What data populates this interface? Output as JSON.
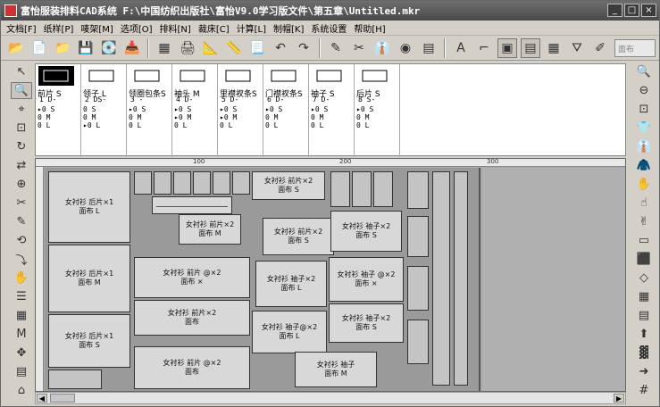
{
  "window": {
    "title": "富怡服装排料CAD系统 F:\\中国纺织出版社\\富怡V9.0学习版文件\\第五章\\Untitled.mkr",
    "buttons": {
      "minimize": "_",
      "maximize": "□",
      "close": "×"
    }
  },
  "menu": [
    "文档[F]",
    "纸样[P]",
    "唛架[M]",
    "选项[O]",
    "排料[N]",
    "裁床[C]",
    "计算[L]",
    "制帽[K]",
    "系统设置",
    "帮助[H]"
  ],
  "toolbar": {
    "icons": [
      "open-icon",
      "new-icon",
      "open-style-icon",
      "save-icon",
      "save-as-icon",
      "import-icon",
      "fill-icon",
      "print-icon",
      "plot-icon",
      "ruler-icon",
      "paper-icon",
      "undo-icon",
      "redo-icon",
      "marker-icon",
      "scissors-icon",
      "shirt-icon",
      "circle-icon",
      "calc-icon",
      "text-icon",
      "measure-icon",
      "window1-icon",
      "window2-icon",
      "grid-icon",
      "tag-icon",
      "roll-icon",
      "wash-icon",
      "piece-icon"
    ],
    "combo_placeholder": "面布"
  },
  "pieces": [
    {
      "name": "前片",
      "size": "S",
      "num": "1",
      "count": "D-",
      "sizes": [
        "0 S",
        "0 M",
        "0 L"
      ],
      "marked": [
        0
      ]
    },
    {
      "name": "领子",
      "size": "L",
      "num": "2",
      "count": "DS-",
      "sizes": [
        "0 S",
        "0 M",
        "0 L"
      ],
      "marked": [
        2
      ]
    },
    {
      "name": "领圈包条S",
      "size": "",
      "num": "3",
      "count": "-",
      "sizes": [
        "0 S",
        "0 M",
        "0 L"
      ],
      "marked": [
        0
      ]
    },
    {
      "name": "袖头",
      "size": "M",
      "num": "4",
      "count": "D-",
      "sizes": [
        "0 S",
        "0 M",
        "0 L"
      ],
      "marked": [
        0,
        1
      ]
    },
    {
      "name": "里襟衩条S",
      "size": "",
      "num": "5",
      "count": "D-",
      "sizes": [
        "0 S",
        "0 M",
        "0 L"
      ],
      "marked": [
        0,
        1
      ]
    },
    {
      "name": "门襟衩条S",
      "size": "",
      "num": "6",
      "count": "D-",
      "sizes": [
        "0 S",
        "0 M",
        "0 L"
      ],
      "marked": [
        0
      ]
    },
    {
      "name": "袖子",
      "size": "S",
      "num": "7",
      "count": "D-",
      "sizes": [
        "0 S",
        "0 M",
        "0 L"
      ],
      "marked": [
        0
      ]
    },
    {
      "name": "后片",
      "size": "S",
      "num": "8",
      "count": "S-",
      "sizes": [
        "0 S",
        "0 M",
        "0 L"
      ],
      "marked": [
        0
      ]
    }
  ],
  "ruler": {
    "labels": [
      "100",
      "200",
      "300"
    ]
  },
  "marker_labels": {
    "back_l": [
      "女衬衫 后片×1",
      "面布 L"
    ],
    "back_m": [
      "女衬衫 后片×1",
      "面布 M"
    ],
    "back_s": [
      "女衬衫 后片×1",
      "面布 S"
    ],
    "front_m": [
      "女衬衫 前片×2",
      "面布 M"
    ],
    "front_s1": [
      "女衬衫 前片×2",
      "面布 S"
    ],
    "front_s2": [
      "女衬衫 前片×2",
      "面布 S"
    ],
    "front_x1": [
      "女衬衫 前片 @×2",
      "面布 ×"
    ],
    "front_x2": [
      "女衬衫 前片×2",
      "面布"
    ],
    "front_x3": [
      "女衬衫 前片 @×2",
      "面布"
    ],
    "sleeve_s1": [
      "女衬衫 袖子×2",
      "面布 S"
    ],
    "sleeve_l1": [
      "女衬衫 袖子×2",
      "面布 L"
    ],
    "sleeve_x1": [
      "女衬衫 袖子 @×2",
      "面布 ×"
    ],
    "sleeve_s2": [
      "女衬衫 袖子×2",
      "面布 S"
    ],
    "sleeve_l2": [
      "女衬衫 袖子@×2",
      "面布 L"
    ],
    "sleeve_m": [
      "女衬衫 袖子",
      "面布 M"
    ]
  },
  "colors": {
    "titlebar": "#4a4a4a",
    "canvas": "#a8a8a8",
    "piece": "#d8d8d8"
  }
}
